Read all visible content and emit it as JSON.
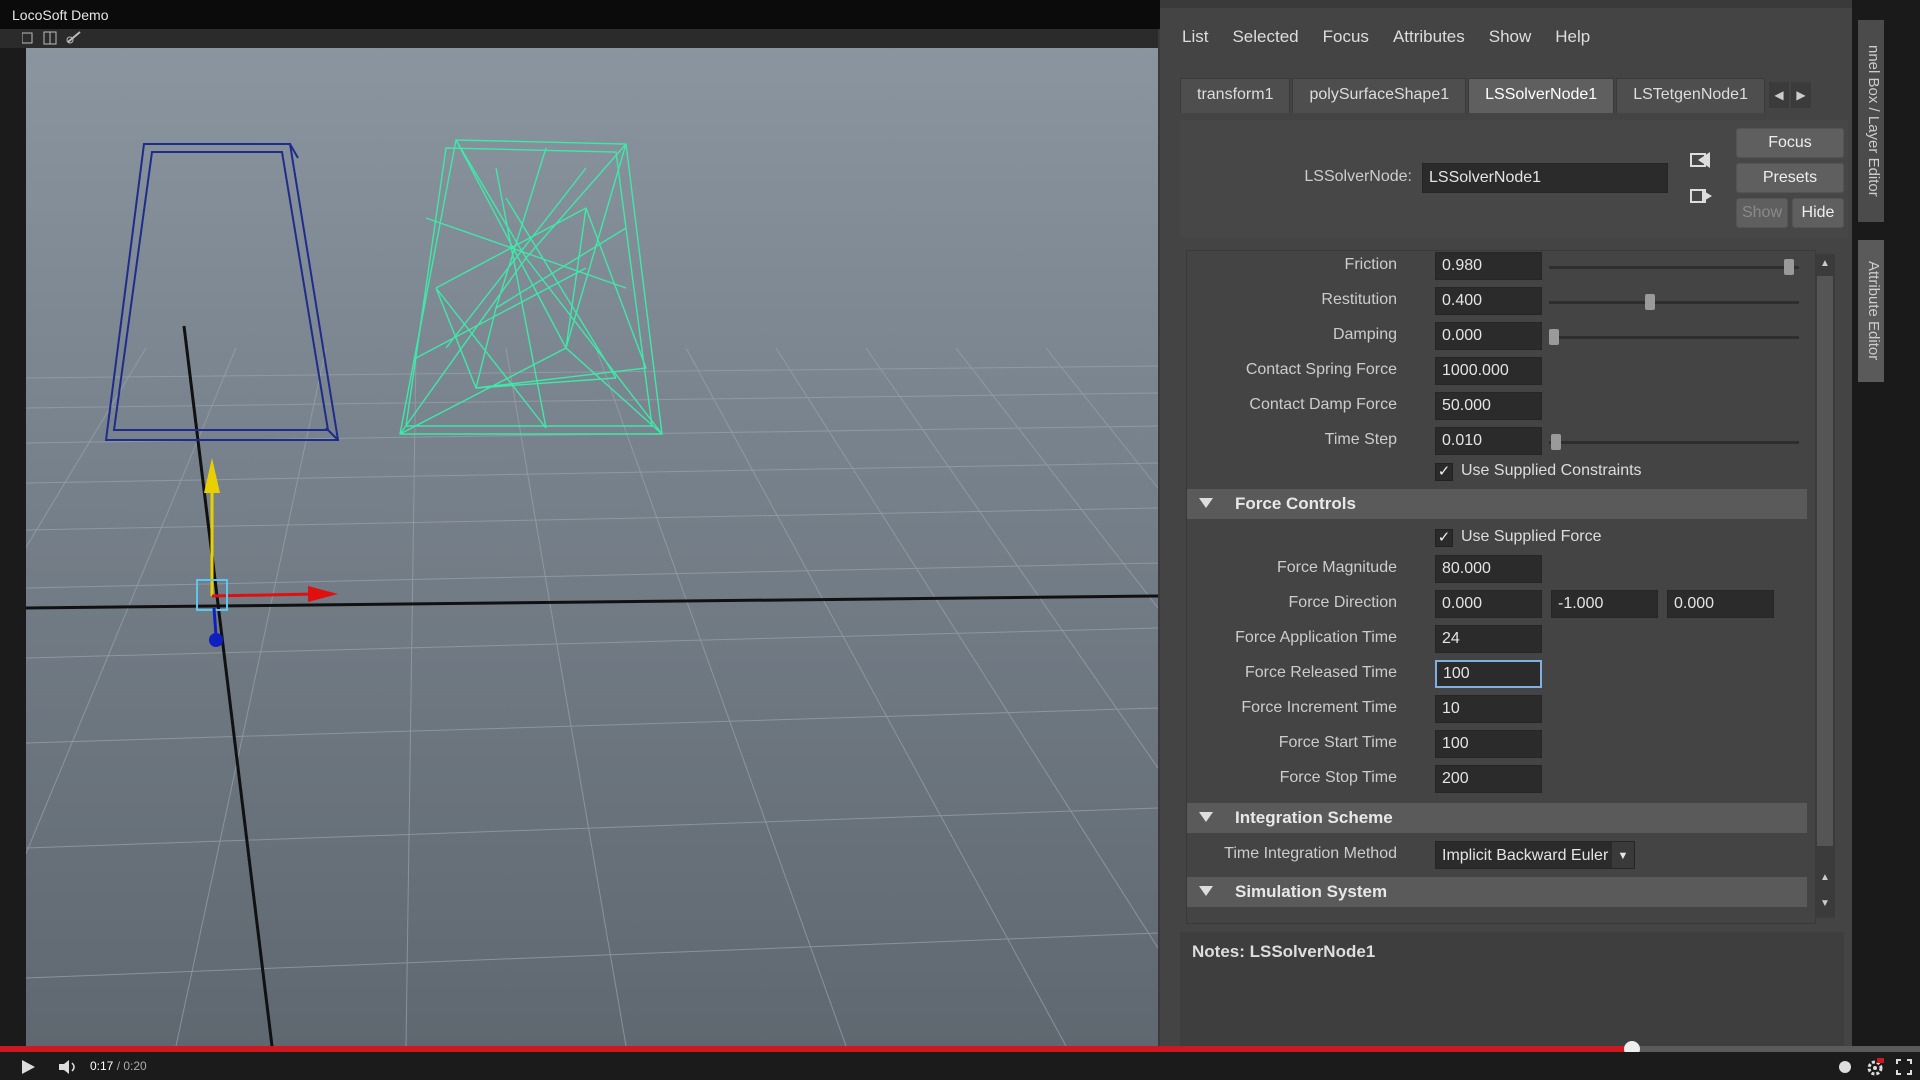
{
  "app": {
    "title": "LocoSoft Demo"
  },
  "menu": [
    "List",
    "Selected",
    "Focus",
    "Attributes",
    "Show",
    "Help"
  ],
  "tabs": [
    {
      "label": "transform1",
      "active": false
    },
    {
      "label": "polySurfaceShape1",
      "active": false
    },
    {
      "label": "LSSolverNode1",
      "active": true
    },
    {
      "label": "LSTetgenNode1",
      "active": false
    }
  ],
  "node": {
    "label": "LSSolverNode:",
    "value": "LSSolverNode1",
    "buttons": {
      "focus": "Focus",
      "presets": "Presets",
      "show": "Show",
      "hide": "Hide"
    }
  },
  "attributes": {
    "friction": {
      "label": "Friction",
      "value": "0.980",
      "slider": 0.98
    },
    "restitution": {
      "label": "Restitution",
      "value": "0.400",
      "slider": 0.4
    },
    "damping": {
      "label": "Damping",
      "value": "0.000",
      "slider": 0.0
    },
    "contact_spring": {
      "label": "Contact Spring Force",
      "value": "1000.000"
    },
    "contact_damp": {
      "label": "Contact Damp Force",
      "value": "50.000"
    },
    "time_step": {
      "label": "Time Step",
      "value": "0.010",
      "slider": 0.01
    },
    "use_constraints": {
      "label": "Use Supplied Constraints",
      "checked": true
    }
  },
  "force_controls": {
    "title": "Force Controls",
    "use_force": {
      "label": "Use Supplied Force",
      "checked": true
    },
    "magnitude": {
      "label": "Force Magnitude",
      "value": "80.000"
    },
    "direction": {
      "label": "Force Direction",
      "x": "0.000",
      "y": "-1.000",
      "z": "0.000"
    },
    "application_time": {
      "label": "Force Application Time",
      "value": "24"
    },
    "released_time": {
      "label": "Force Released Time",
      "value": "100"
    },
    "increment_time": {
      "label": "Force Increment Time",
      "value": "10"
    },
    "start_time": {
      "label": "Force Start Time",
      "value": "100"
    },
    "stop_time": {
      "label": "Force Stop Time",
      "value": "200"
    }
  },
  "integration": {
    "title": "Integration Scheme",
    "method_label": "Time Integration Method",
    "method_value": "Implicit Backward Euler"
  },
  "simulation": {
    "title": "Simulation System"
  },
  "notes": {
    "label": "Notes: LSSolverNode1"
  },
  "side_tabs": [
    "nnel Box / Layer Editor",
    "Attribute Editor"
  ],
  "video": {
    "current": "0:17",
    "duration": "0:20",
    "progress": 0.85
  },
  "colors": {
    "progress": "#cc181e",
    "wire_blue": "#1f2c8a",
    "wire_green": "#3fe8a8"
  }
}
